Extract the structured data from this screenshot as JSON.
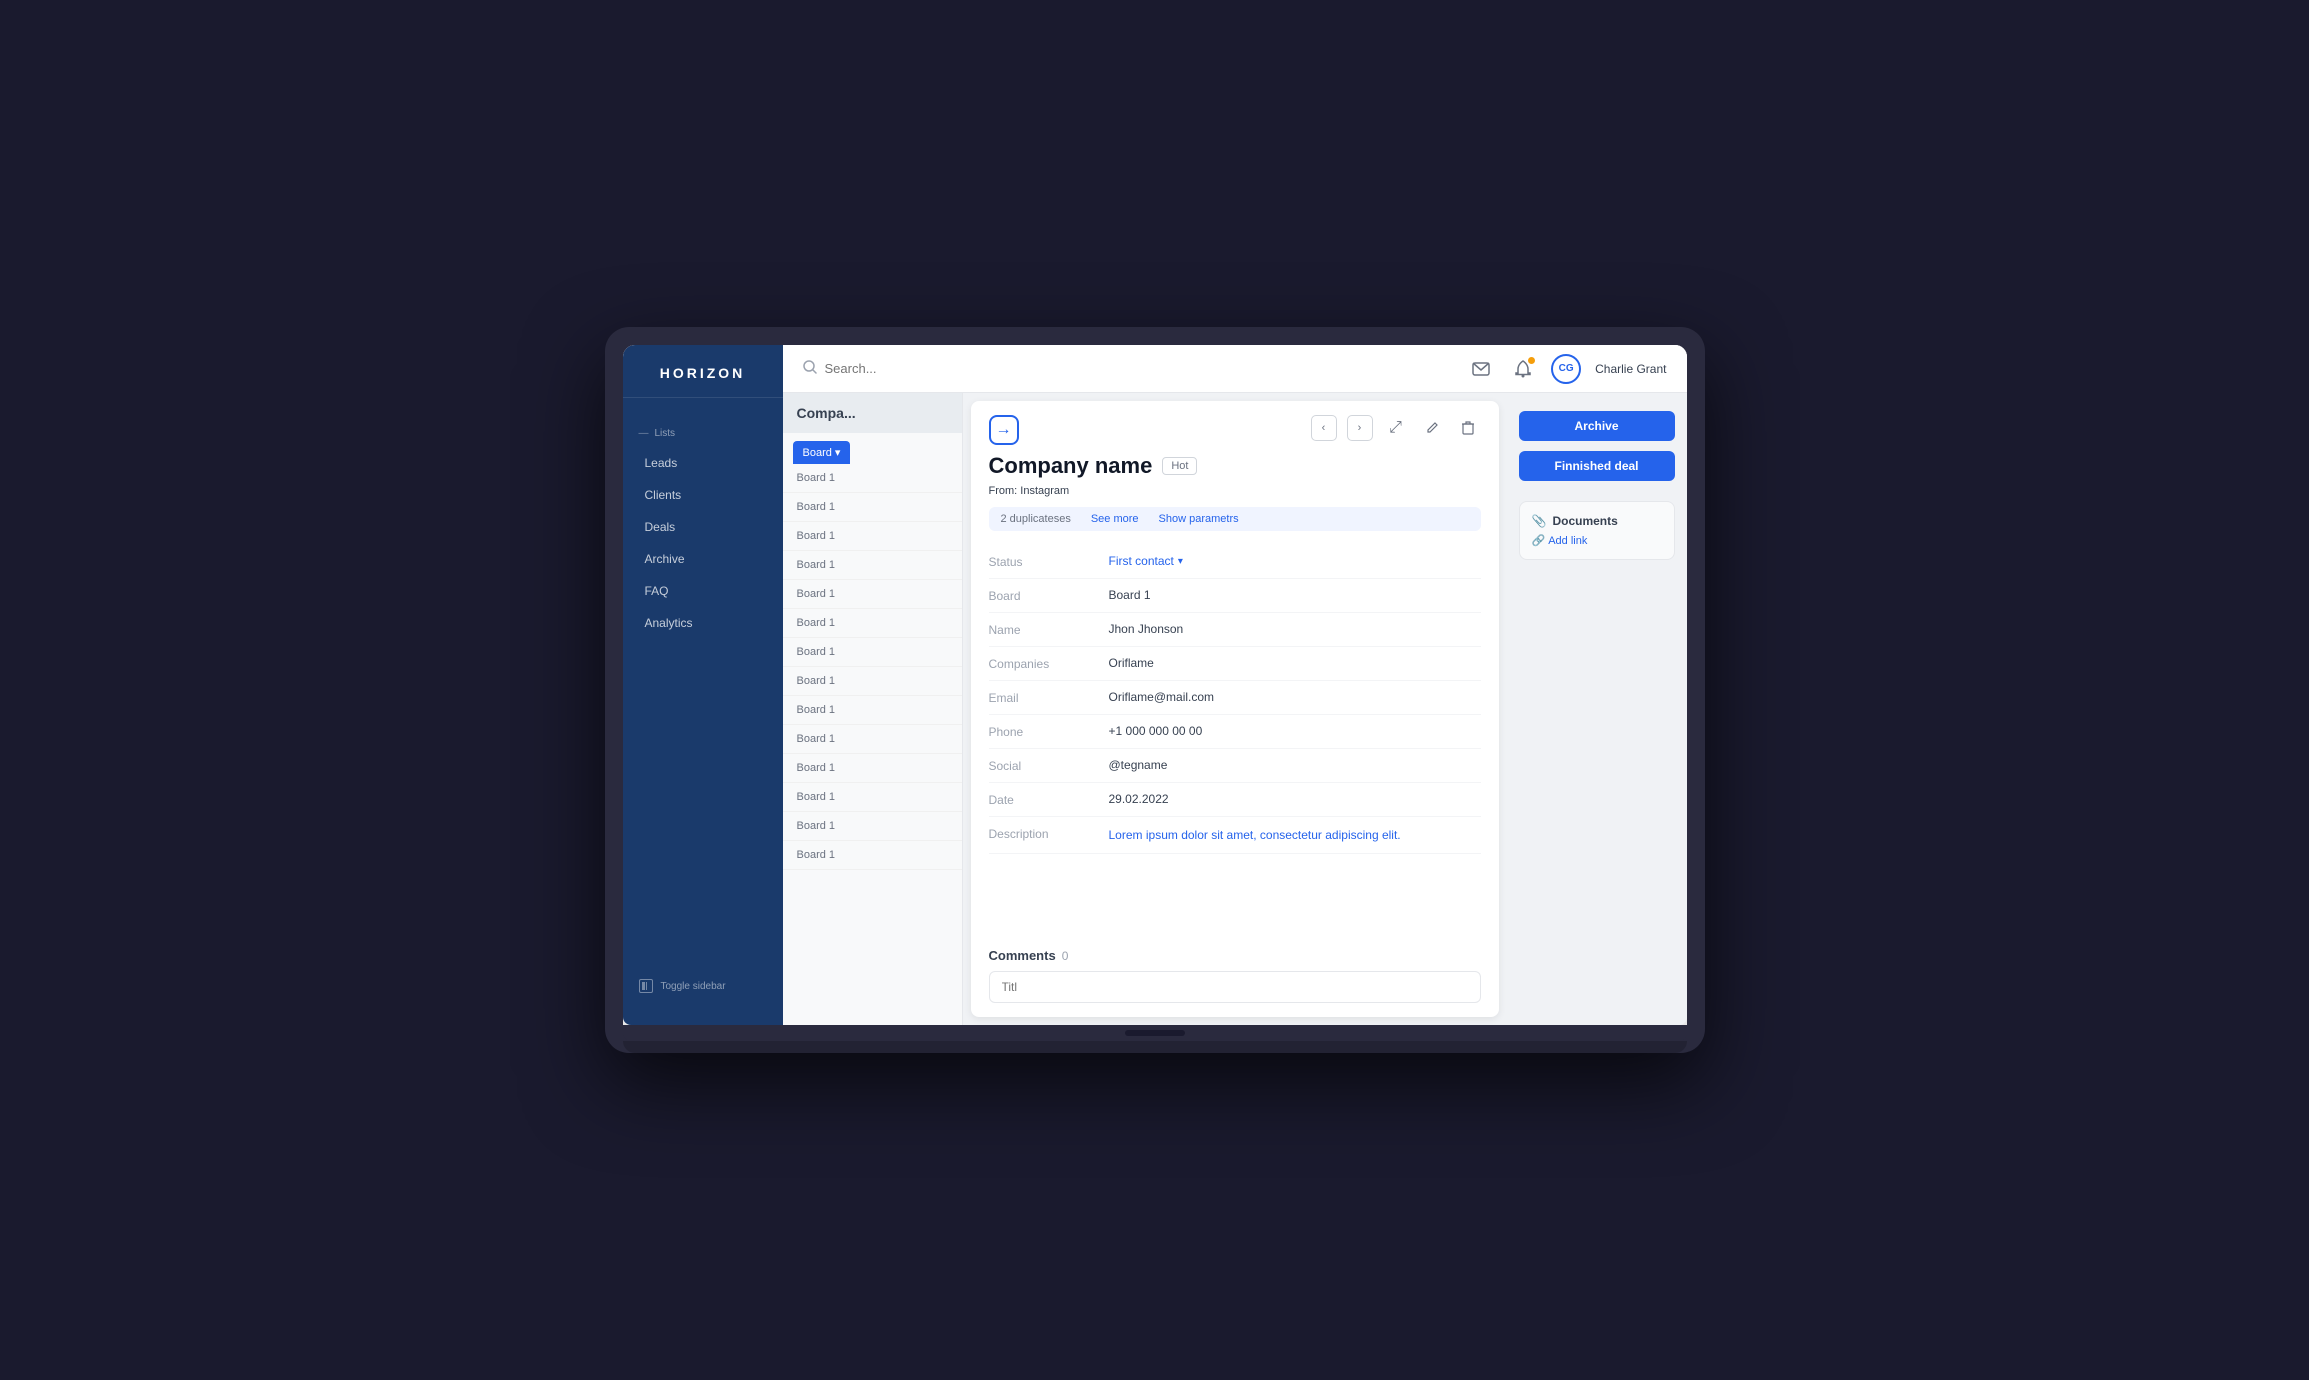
{
  "app": {
    "logo": "HORIZON",
    "toggle_sidebar_label": "Toggle sidebar"
  },
  "sidebar": {
    "section_label": "Lists",
    "items": [
      {
        "label": "Leads",
        "id": "leads"
      },
      {
        "label": "Clients",
        "id": "clients"
      },
      {
        "label": "Deals",
        "id": "deals"
      },
      {
        "label": "Archive",
        "id": "archive"
      },
      {
        "label": "FAQ",
        "id": "faq"
      },
      {
        "label": "Analytics",
        "id": "analytics"
      }
    ]
  },
  "topbar": {
    "search_placeholder": "Search...",
    "user_initials": "CG",
    "user_name": "Charlie Grant"
  },
  "board": {
    "title": "Compa...",
    "active_tab": "Board",
    "tab_dropdown": "▾",
    "items": [
      "Board 1",
      "Board 1",
      "Board 1",
      "Board 1",
      "Board 1",
      "Board 1",
      "Board 1",
      "Board 1",
      "Board 1",
      "Board 1",
      "Board 1",
      "Board 1",
      "Board 1",
      "Board 1"
    ]
  },
  "detail": {
    "company_name": "Company name",
    "hot_badge": "Hot",
    "from_label": "From:",
    "from_value": "Instagram",
    "duplicates_count": "2 duplicateses",
    "see_more": "See more",
    "show_params": "Show parametrs",
    "fields": [
      {
        "label": "Status",
        "value": "First contact",
        "type": "status"
      },
      {
        "label": "Board",
        "value": "Board 1",
        "type": "text"
      },
      {
        "label": "Name",
        "value": "Jhon Jhonson",
        "type": "text"
      },
      {
        "label": "Companies",
        "value": "Oriflame",
        "type": "text"
      },
      {
        "label": "Email",
        "value": "Oriflame@mail.com",
        "type": "text"
      },
      {
        "label": "Phone",
        "value": "+1 000 000 00 00",
        "type": "text"
      },
      {
        "label": "Social",
        "value": "@tegname",
        "type": "text"
      },
      {
        "label": "Date",
        "value": "29.02.2022",
        "type": "text"
      },
      {
        "label": "Description",
        "value": "Lorem ipsum dolor sit amet, consectetur adipiscing elit.",
        "type": "link"
      }
    ],
    "comments_label": "Comments",
    "comments_count": "0",
    "comment_placeholder": "Titl"
  },
  "right_panel": {
    "archive_btn": "Archive",
    "finished_deal_btn": "Finnished deal",
    "documents_label": "Documents",
    "add_link_label": "Add link"
  }
}
